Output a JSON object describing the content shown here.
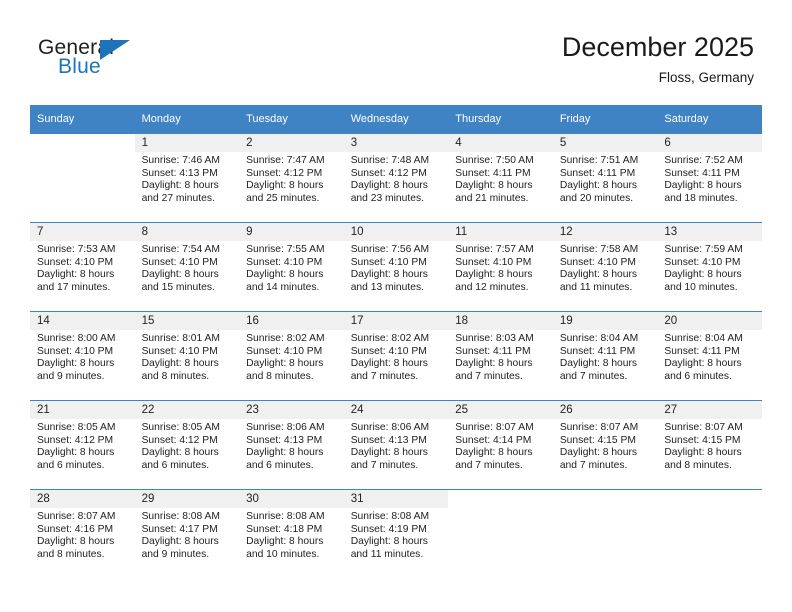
{
  "brand": {
    "name_part1": "General",
    "name_part2": "Blue",
    "triangle_icon": "blue-triangle-icon"
  },
  "header": {
    "title": "December 2025",
    "subtitle": "Floss, Germany"
  },
  "colors": {
    "header_blue": "#4083c4",
    "brand_blue": "#1e74bb",
    "daynum_bg": "#f0f0f0",
    "text": "#222222"
  },
  "calendar": {
    "weekday_headers": [
      "Sunday",
      "Monday",
      "Tuesday",
      "Wednesday",
      "Thursday",
      "Friday",
      "Saturday"
    ],
    "weeks": [
      [
        {
          "day": "",
          "sunrise": "",
          "sunset": "",
          "daylight_line1": "",
          "daylight_line2": ""
        },
        {
          "day": "1",
          "sunrise": "Sunrise: 7:46 AM",
          "sunset": "Sunset: 4:13 PM",
          "daylight_line1": "Daylight: 8 hours",
          "daylight_line2": "and 27 minutes."
        },
        {
          "day": "2",
          "sunrise": "Sunrise: 7:47 AM",
          "sunset": "Sunset: 4:12 PM",
          "daylight_line1": "Daylight: 8 hours",
          "daylight_line2": "and 25 minutes."
        },
        {
          "day": "3",
          "sunrise": "Sunrise: 7:48 AM",
          "sunset": "Sunset: 4:12 PM",
          "daylight_line1": "Daylight: 8 hours",
          "daylight_line2": "and 23 minutes."
        },
        {
          "day": "4",
          "sunrise": "Sunrise: 7:50 AM",
          "sunset": "Sunset: 4:11 PM",
          "daylight_line1": "Daylight: 8 hours",
          "daylight_line2": "and 21 minutes."
        },
        {
          "day": "5",
          "sunrise": "Sunrise: 7:51 AM",
          "sunset": "Sunset: 4:11 PM",
          "daylight_line1": "Daylight: 8 hours",
          "daylight_line2": "and 20 minutes."
        },
        {
          "day": "6",
          "sunrise": "Sunrise: 7:52 AM",
          "sunset": "Sunset: 4:11 PM",
          "daylight_line1": "Daylight: 8 hours",
          "daylight_line2": "and 18 minutes."
        }
      ],
      [
        {
          "day": "7",
          "sunrise": "Sunrise: 7:53 AM",
          "sunset": "Sunset: 4:10 PM",
          "daylight_line1": "Daylight: 8 hours",
          "daylight_line2": "and 17 minutes."
        },
        {
          "day": "8",
          "sunrise": "Sunrise: 7:54 AM",
          "sunset": "Sunset: 4:10 PM",
          "daylight_line1": "Daylight: 8 hours",
          "daylight_line2": "and 15 minutes."
        },
        {
          "day": "9",
          "sunrise": "Sunrise: 7:55 AM",
          "sunset": "Sunset: 4:10 PM",
          "daylight_line1": "Daylight: 8 hours",
          "daylight_line2": "and 14 minutes."
        },
        {
          "day": "10",
          "sunrise": "Sunrise: 7:56 AM",
          "sunset": "Sunset: 4:10 PM",
          "daylight_line1": "Daylight: 8 hours",
          "daylight_line2": "and 13 minutes."
        },
        {
          "day": "11",
          "sunrise": "Sunrise: 7:57 AM",
          "sunset": "Sunset: 4:10 PM",
          "daylight_line1": "Daylight: 8 hours",
          "daylight_line2": "and 12 minutes."
        },
        {
          "day": "12",
          "sunrise": "Sunrise: 7:58 AM",
          "sunset": "Sunset: 4:10 PM",
          "daylight_line1": "Daylight: 8 hours",
          "daylight_line2": "and 11 minutes."
        },
        {
          "day": "13",
          "sunrise": "Sunrise: 7:59 AM",
          "sunset": "Sunset: 4:10 PM",
          "daylight_line1": "Daylight: 8 hours",
          "daylight_line2": "and 10 minutes."
        }
      ],
      [
        {
          "day": "14",
          "sunrise": "Sunrise: 8:00 AM",
          "sunset": "Sunset: 4:10 PM",
          "daylight_line1": "Daylight: 8 hours",
          "daylight_line2": "and 9 minutes."
        },
        {
          "day": "15",
          "sunrise": "Sunrise: 8:01 AM",
          "sunset": "Sunset: 4:10 PM",
          "daylight_line1": "Daylight: 8 hours",
          "daylight_line2": "and 8 minutes."
        },
        {
          "day": "16",
          "sunrise": "Sunrise: 8:02 AM",
          "sunset": "Sunset: 4:10 PM",
          "daylight_line1": "Daylight: 8 hours",
          "daylight_line2": "and 8 minutes."
        },
        {
          "day": "17",
          "sunrise": "Sunrise: 8:02 AM",
          "sunset": "Sunset: 4:10 PM",
          "daylight_line1": "Daylight: 8 hours",
          "daylight_line2": "and 7 minutes."
        },
        {
          "day": "18",
          "sunrise": "Sunrise: 8:03 AM",
          "sunset": "Sunset: 4:11 PM",
          "daylight_line1": "Daylight: 8 hours",
          "daylight_line2": "and 7 minutes."
        },
        {
          "day": "19",
          "sunrise": "Sunrise: 8:04 AM",
          "sunset": "Sunset: 4:11 PM",
          "daylight_line1": "Daylight: 8 hours",
          "daylight_line2": "and 7 minutes."
        },
        {
          "day": "20",
          "sunrise": "Sunrise: 8:04 AM",
          "sunset": "Sunset: 4:11 PM",
          "daylight_line1": "Daylight: 8 hours",
          "daylight_line2": "and 6 minutes."
        }
      ],
      [
        {
          "day": "21",
          "sunrise": "Sunrise: 8:05 AM",
          "sunset": "Sunset: 4:12 PM",
          "daylight_line1": "Daylight: 8 hours",
          "daylight_line2": "and 6 minutes."
        },
        {
          "day": "22",
          "sunrise": "Sunrise: 8:05 AM",
          "sunset": "Sunset: 4:12 PM",
          "daylight_line1": "Daylight: 8 hours",
          "daylight_line2": "and 6 minutes."
        },
        {
          "day": "23",
          "sunrise": "Sunrise: 8:06 AM",
          "sunset": "Sunset: 4:13 PM",
          "daylight_line1": "Daylight: 8 hours",
          "daylight_line2": "and 6 minutes."
        },
        {
          "day": "24",
          "sunrise": "Sunrise: 8:06 AM",
          "sunset": "Sunset: 4:13 PM",
          "daylight_line1": "Daylight: 8 hours",
          "daylight_line2": "and 7 minutes."
        },
        {
          "day": "25",
          "sunrise": "Sunrise: 8:07 AM",
          "sunset": "Sunset: 4:14 PM",
          "daylight_line1": "Daylight: 8 hours",
          "daylight_line2": "and 7 minutes."
        },
        {
          "day": "26",
          "sunrise": "Sunrise: 8:07 AM",
          "sunset": "Sunset: 4:15 PM",
          "daylight_line1": "Daylight: 8 hours",
          "daylight_line2": "and 7 minutes."
        },
        {
          "day": "27",
          "sunrise": "Sunrise: 8:07 AM",
          "sunset": "Sunset: 4:15 PM",
          "daylight_line1": "Daylight: 8 hours",
          "daylight_line2": "and 8 minutes."
        }
      ],
      [
        {
          "day": "28",
          "sunrise": "Sunrise: 8:07 AM",
          "sunset": "Sunset: 4:16 PM",
          "daylight_line1": "Daylight: 8 hours",
          "daylight_line2": "and 8 minutes."
        },
        {
          "day": "29",
          "sunrise": "Sunrise: 8:08 AM",
          "sunset": "Sunset: 4:17 PM",
          "daylight_line1": "Daylight: 8 hours",
          "daylight_line2": "and 9 minutes."
        },
        {
          "day": "30",
          "sunrise": "Sunrise: 8:08 AM",
          "sunset": "Sunset: 4:18 PM",
          "daylight_line1": "Daylight: 8 hours",
          "daylight_line2": "and 10 minutes."
        },
        {
          "day": "31",
          "sunrise": "Sunrise: 8:08 AM",
          "sunset": "Sunset: 4:19 PM",
          "daylight_line1": "Daylight: 8 hours",
          "daylight_line2": "and 11 minutes."
        },
        {
          "day": "",
          "sunrise": "",
          "sunset": "",
          "daylight_line1": "",
          "daylight_line2": ""
        },
        {
          "day": "",
          "sunrise": "",
          "sunset": "",
          "daylight_line1": "",
          "daylight_line2": ""
        },
        {
          "day": "",
          "sunrise": "",
          "sunset": "",
          "daylight_line1": "",
          "daylight_line2": ""
        }
      ]
    ]
  }
}
